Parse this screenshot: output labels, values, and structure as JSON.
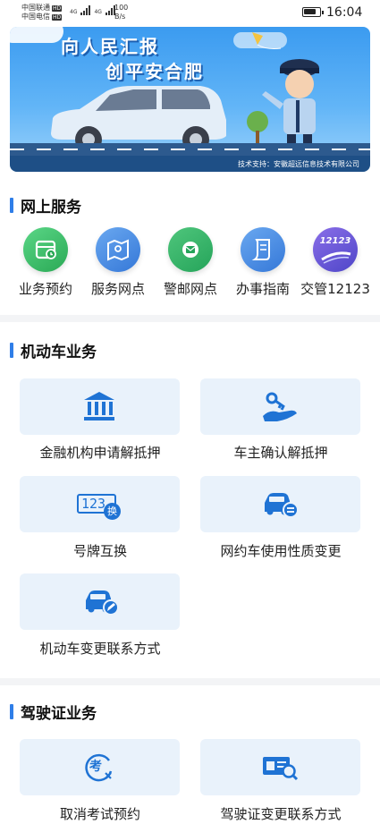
{
  "status_bar": {
    "carrier1": "中国联通",
    "carrier2": "中国电信",
    "hd": "HD",
    "network": "4G",
    "speed_value": "100",
    "speed_unit": "B/s",
    "time": "16:04",
    "battery_level": 0.8
  },
  "banner": {
    "title_line1": "向人民汇报",
    "title_line2": "创平安合肥",
    "credit": "技术支持：安徽超远信息技术有限公司"
  },
  "online_services": {
    "title": "网上服务",
    "items": [
      {
        "label": "业务预约",
        "icon": "calendar-icon",
        "color": "#3fc06a"
      },
      {
        "label": "服务网点",
        "icon": "map-icon",
        "color": "#4a90e2"
      },
      {
        "label": "警邮网点",
        "icon": "mail-icon",
        "color": "#34b36a"
      },
      {
        "label": "办事指南",
        "icon": "guide-icon",
        "color": "#4a90e2"
      },
      {
        "label": "交管12123",
        "icon": "12123-logo-icon",
        "badge": "12123",
        "color": "#6a5ae0"
      }
    ]
  },
  "vehicle_business": {
    "title": "机动车业务",
    "items": [
      {
        "label": "金融机构申请解抵押",
        "icon": "bank-icon"
      },
      {
        "label": "车主确认解抵押",
        "icon": "hand-key-icon"
      },
      {
        "label": "号牌互换",
        "icon": "plate-swap-icon",
        "plate": "123",
        "badge": "换"
      },
      {
        "label": "网约车使用性质变更",
        "icon": "car-change-icon"
      },
      {
        "label": "机动车变更联系方式",
        "icon": "car-edit-icon"
      }
    ]
  },
  "license_business": {
    "title": "驾驶证业务",
    "items": [
      {
        "label": "取消考试预约",
        "icon": "cancel-exam-icon",
        "badge": "考"
      },
      {
        "label": "驾驶证变更联系方式",
        "icon": "license-search-icon"
      }
    ]
  },
  "colors": {
    "accent": "#2f7ee8",
    "card_bg": "#e9f2fb",
    "icon_blue": "#1f73d4"
  }
}
